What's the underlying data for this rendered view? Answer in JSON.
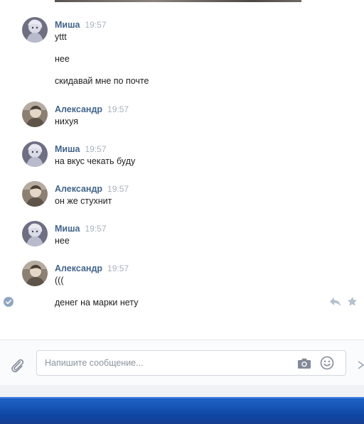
{
  "messages": [
    {
      "author": "Миша",
      "time": "19:57",
      "avatar": "misha",
      "lines": [
        "yttt",
        "нее",
        "скидавай мне по почте"
      ]
    },
    {
      "author": "Александр",
      "time": "19:57",
      "avatar": "alexandr",
      "lines": [
        "нихуя"
      ]
    },
    {
      "author": "Миша",
      "time": "19:57",
      "avatar": "misha",
      "lines": [
        "на вкус чекать буду"
      ]
    },
    {
      "author": "Александр",
      "time": "19:57",
      "avatar": "alexandr",
      "lines": [
        "он же стухнит"
      ]
    },
    {
      "author": "Миша",
      "time": "19:57",
      "avatar": "misha",
      "lines": [
        "нее"
      ]
    },
    {
      "author": "Александр",
      "time": "19:57",
      "avatar": "alexandr",
      "lines": [
        "(((",
        "денег на марки нету"
      ]
    }
  ],
  "composer": {
    "placeholder": "Напишите сообщение..."
  },
  "icons": {
    "read": "checkmark-circle-icon",
    "reply": "reply-icon",
    "star": "star-icon",
    "attach": "paperclip-icon",
    "camera": "camera-icon",
    "emoji": "smile-icon"
  },
  "colors": {
    "author": "#42648b",
    "time": "#a8b2bd",
    "taskbar": "#1756b6"
  }
}
